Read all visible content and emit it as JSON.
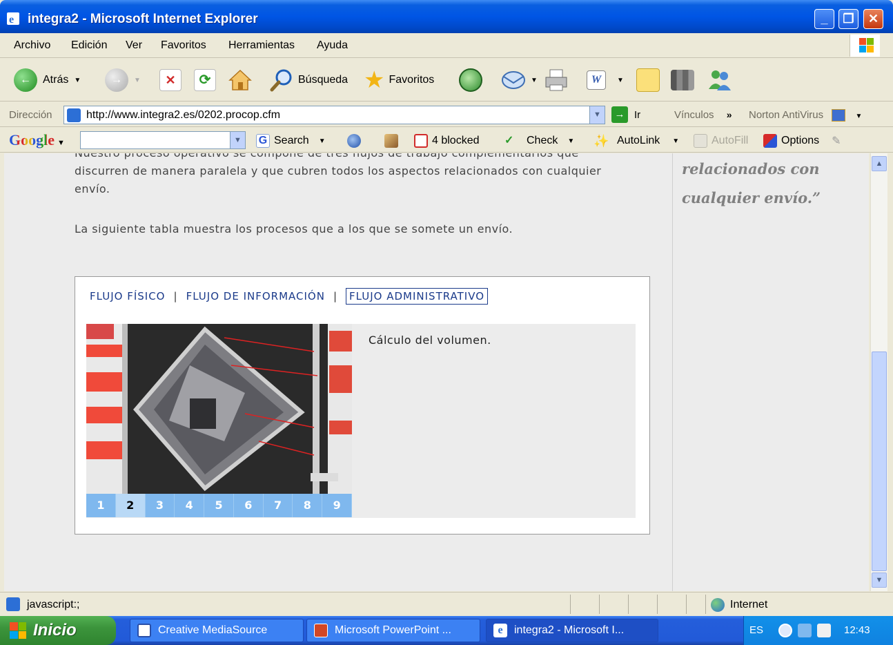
{
  "window": {
    "title": "integra2 - Microsoft Internet Explorer"
  },
  "menu": {
    "items": [
      "Archivo",
      "Edición",
      "Ver",
      "Favoritos",
      "Herramientas",
      "Ayuda"
    ]
  },
  "toolbar": {
    "back_label": "Atrás",
    "search_label": "Búsqueda",
    "favorites_label": "Favoritos"
  },
  "address": {
    "label": "Dirección",
    "url": "http://www.integra2.es/0202.procop.cfm",
    "go_label": "Ir",
    "links_label": "Vínculos",
    "more_label": "»",
    "norton_label": "Norton AntiVirus"
  },
  "google": {
    "logo": "Google",
    "search_label": "Search",
    "blocked_label": "4 blocked",
    "check_label": "Check",
    "autolink_label": "AutoLink",
    "autofill_label": "AutoFill",
    "options_label": "Options"
  },
  "content": {
    "intro_top": "Nuestro proceso operativo se compone de tres flujos de trabajo complementarios que",
    "intro_line2": "discurren de manera paralela y que cubren todos los aspectos relacionados con cualquier",
    "intro_line3": "envío.",
    "table_intro": "La siguiente tabla muestra los procesos que a los que se somete un envío.",
    "quote_line1": "relacionados con",
    "quote_line2": "cualquier envío.”",
    "tabs": {
      "physical": "FLUJO FÍSICO",
      "info": "FLUJO DE INFORMACIÓN",
      "admin": "FLUJO ADMINISTRATIVO",
      "separator": "|"
    },
    "caption": "Cálculo del volumen.",
    "steps": [
      "1",
      "2",
      "3",
      "4",
      "5",
      "6",
      "7",
      "8",
      "9"
    ],
    "current_step": "2"
  },
  "status": {
    "text": "javascript:;",
    "zone": "Internet"
  },
  "taskbar": {
    "start_label": "Inicio",
    "tasks": [
      "Creative MediaSource",
      "Microsoft PowerPoint ...",
      "integra2 - Microsoft I..."
    ],
    "language": "ES",
    "clock": "12:43"
  }
}
